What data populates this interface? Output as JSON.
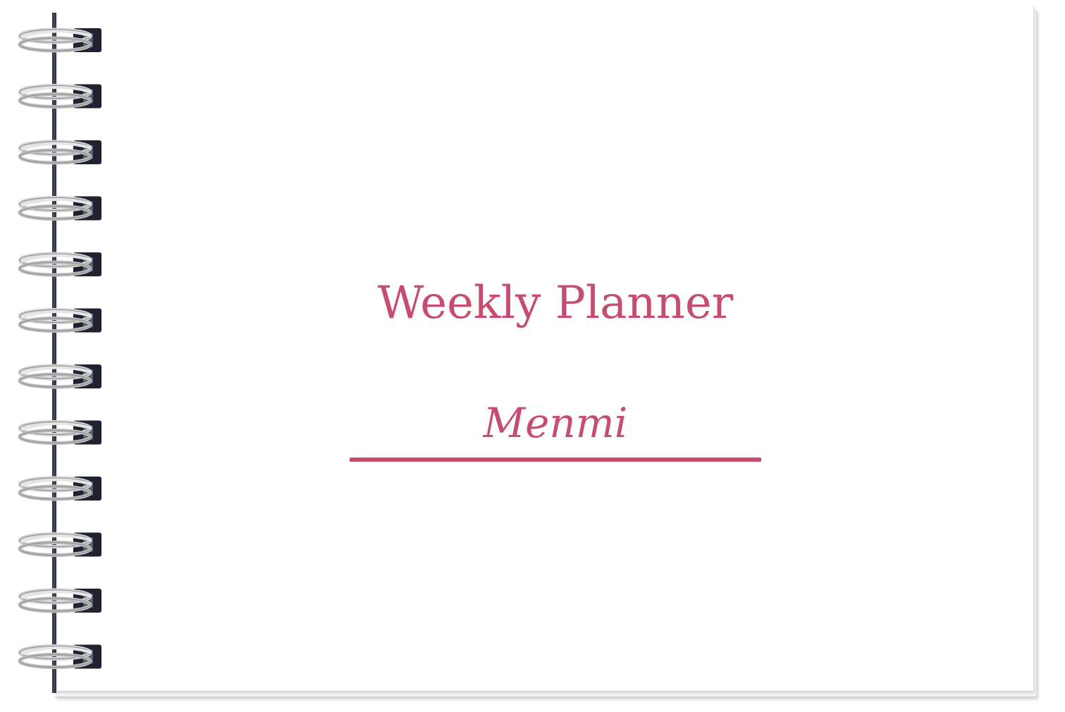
{
  "cover": {
    "title": "Weekly Planner",
    "owner_name": "Menmi"
  },
  "colors": {
    "accent": "#c74d70",
    "spine": "#2a2d3b",
    "ring": "#c9c9c9"
  },
  "icons": {
    "binding": "spiral-binding-icon"
  }
}
